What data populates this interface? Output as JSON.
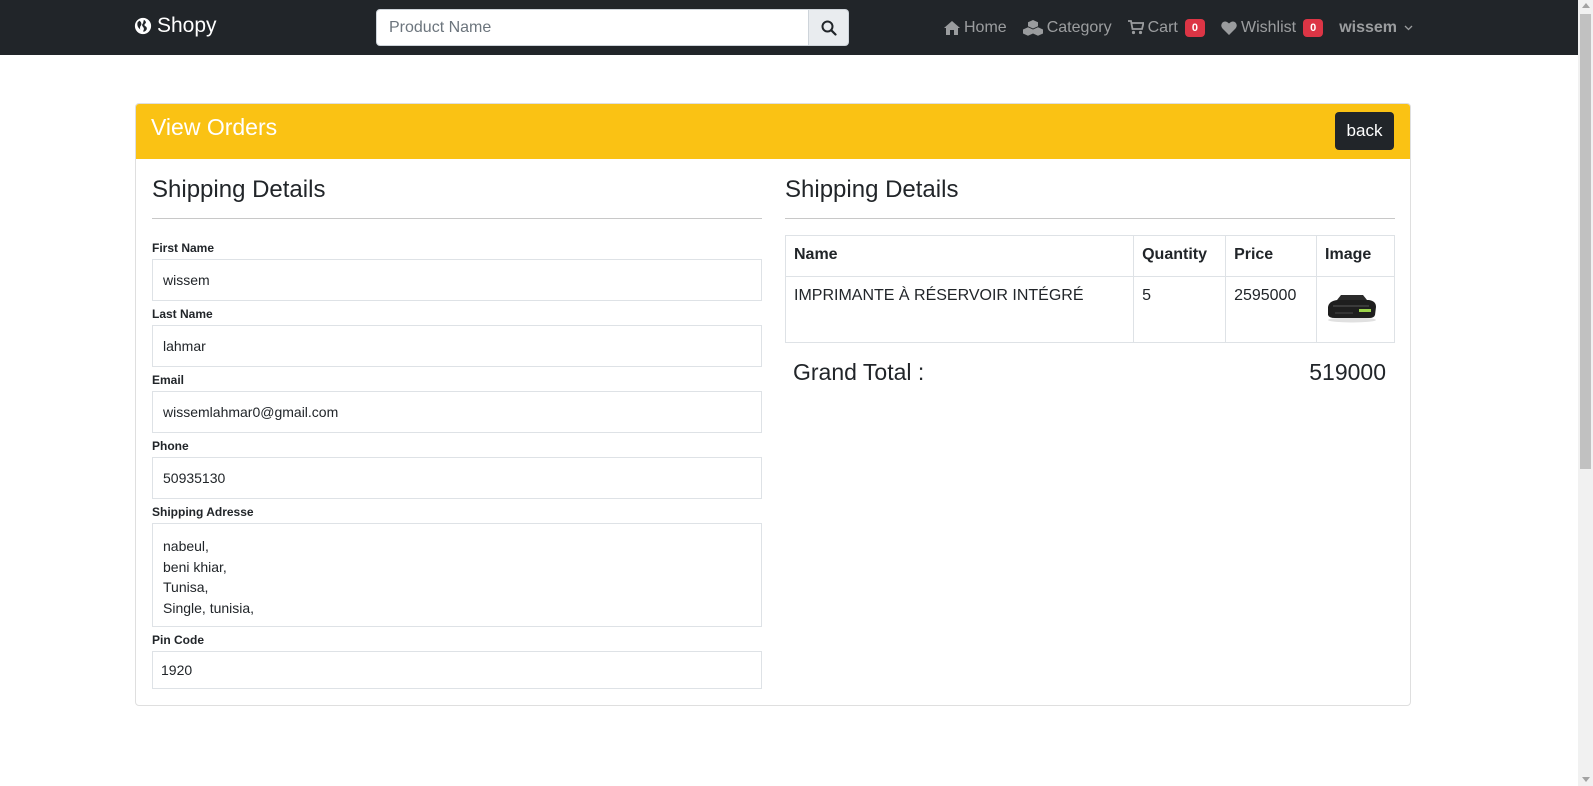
{
  "navbar": {
    "brand": "Shopy",
    "search_placeholder": "Product Name",
    "links": {
      "home": "Home",
      "category": "Category",
      "cart": "Cart",
      "cart_count": "0",
      "wishlist": "Wishlist",
      "wishlist_count": "0"
    },
    "user": "wissem"
  },
  "card": {
    "title": "View Orders",
    "back_label": "back"
  },
  "shipping_form": {
    "title": "Shipping Details",
    "first_name_label": "First Name",
    "first_name": "wissem",
    "last_name_label": "Last Name",
    "last_name": "lahmar",
    "email_label": "Email",
    "email": "wissemlahmar0@gmail.com",
    "phone_label": "Phone",
    "phone": "50935130",
    "address_label": "Shipping Adresse",
    "address_lines": [
      "nabeul,",
      "beni khiar,",
      "Tunisa,",
      "Single, tunisia,"
    ],
    "pin_label": "Pin Code",
    "pin": "1920"
  },
  "order": {
    "title": "Shipping Details",
    "columns": [
      "Name",
      "Quantity",
      "Price",
      "Image"
    ],
    "rows": [
      {
        "name": "IMPRIMANTE À RÉSERVOIR INTÉGRÉ",
        "quantity": "5",
        "price": "2595000",
        "image": "printer-image"
      }
    ],
    "grand_total_label": "Grand Total :",
    "grand_total_value": "519000"
  },
  "colors": {
    "navbar": "#212529",
    "header": "#fac214",
    "badge": "#dc3545"
  }
}
